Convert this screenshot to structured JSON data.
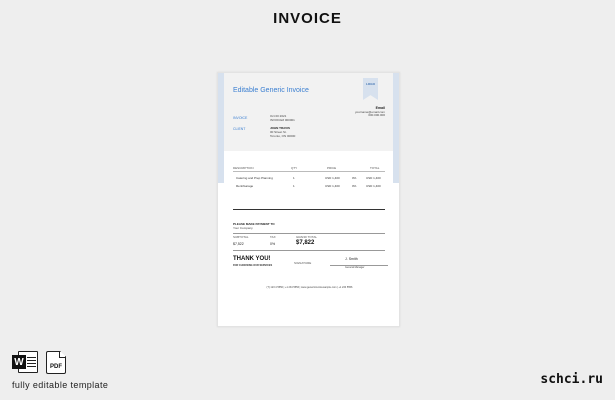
{
  "page": {
    "title": "INVOICE"
  },
  "invoice": {
    "heading": "Editable Generic Invoice",
    "ribbon": "LOGO",
    "from": {
      "name": "Email",
      "line1": "yourname@email.com",
      "line2": "000.000.000"
    },
    "invoice_label": "INVOICE",
    "invoice_meta": [
      "Oct 00 2021",
      "INVOICE# 000001"
    ],
    "client_label": "CLIENT",
    "client": {
      "name": "JOHN TRAVIS",
      "line1": "00 Street St.",
      "line2": "Toronto, ON 00000"
    },
    "table": {
      "headers": [
        "DESCRIPTION",
        "QTY",
        "PRICE",
        "TOTAL"
      ],
      "rows": [
        {
          "desc": "Catering and Prep Planning",
          "qty": "1",
          "price": "USD 1,400",
          "tax": "0%",
          "total": "USD 1,400"
        },
        {
          "desc": "Rent/Garage",
          "qty": "1",
          "price": "USD 1,400",
          "tax": "0%",
          "total": "USD 1,400"
        }
      ]
    },
    "payment": {
      "label": "PLEASE MAKE PAYMENT TO",
      "company": "Your Company"
    },
    "summary": {
      "subtotal_label": "SUBTOTAL",
      "subtotal": "$7,522",
      "tax_label": "TAX",
      "tax": "0%",
      "grand_label": "GRAND TOTAL",
      "grand": "$7,822"
    },
    "thanks": "THANK YOU!",
    "thanks_sub": "FOR CHOOSING OUR SERVICES",
    "signature_label": "SIGNATURE",
    "signer_name": "J. Smith",
    "signer_title": "General Manager",
    "footer": "(T) 123 4 5556   |   +1 234 5556   |   www.genericinvoicesample.com   |   +1 234 5556"
  },
  "bottom": {
    "word_letter": "W",
    "pdf_label": "PDF",
    "caption": "fully editable template",
    "brand": "schci.ru"
  }
}
